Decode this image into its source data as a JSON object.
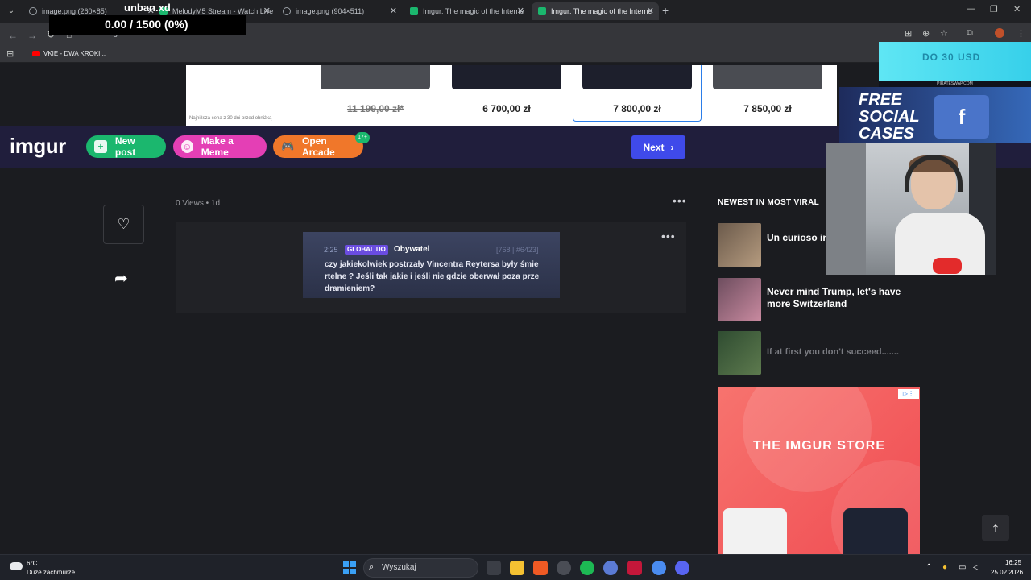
{
  "browser": {
    "tabs": [
      {
        "title": "image.png (260×85)"
      },
      {
        "title": "MelodyM5 Stream - Watch Live"
      },
      {
        "title": "image.png (904×511)"
      },
      {
        "title": "Imgur: The magic of the Interne"
      },
      {
        "title": "Imgur: The magic of the Interne"
      }
    ],
    "tab_close": "✕",
    "new_tab": "+",
    "url": "imgur.com/a/XACPZ7I",
    "bookmark": "VKIE - DWA KROKI...",
    "window_controls": [
      "—",
      "❐",
      "✕"
    ]
  },
  "stream_overlay": {
    "title": "unban.xd",
    "counter": "0.00 / 1500 (0%)"
  },
  "ad_banner": {
    "products": [
      {
        "price": "11 199,00 zł*",
        "old": true
      },
      {
        "price": "6 700,00 zł",
        "old": false
      },
      {
        "price": "7 800,00 zł",
        "old": false
      },
      {
        "price": "7 850,00 zł",
        "old": false
      }
    ],
    "note": "Najniższa cena z 30 dni przed obniżką"
  },
  "imgur_header": {
    "logo": "imgur",
    "new_post": "New post",
    "make_meme": "Make a Meme",
    "open_arcade": "Open Arcade",
    "arcade_badge": "17+",
    "next": "Next"
  },
  "post": {
    "views": "0 Views",
    "age": "1d",
    "image_text": {
      "timestamp": "2:25",
      "tag": "GLOBAL DO",
      "user": "Obywatel",
      "id": "[768 | #6423]",
      "message": "czy jakiekolwiek postrzały Vincentra Reytersa były śmie rtelne ? Jeśli tak jakie i jeśli nie gdzie oberwał poza prze dramieniem?"
    }
  },
  "sidebar": {
    "title": "NEWEST IN MOST VIRAL",
    "items": [
      {
        "text": "Un curioso ins conocía (SON"
      },
      {
        "text": "Never mind Trump, let's have more Switzerland"
      },
      {
        "text": "If at first you don't succeed......."
      }
    ],
    "store_ad": "THE IMGUR STORE"
  },
  "overlays": {
    "promo_top": "DO 30 USD",
    "promo_site": "PIRATESWAP.COM",
    "promo_cases": "FREE SOCIAL CASES"
  },
  "taskbar": {
    "temperature": "6°C",
    "weather": "Duże zachmurze...",
    "search": "Wyszukaj",
    "time": "16:25",
    "date": "25.02.2026"
  }
}
